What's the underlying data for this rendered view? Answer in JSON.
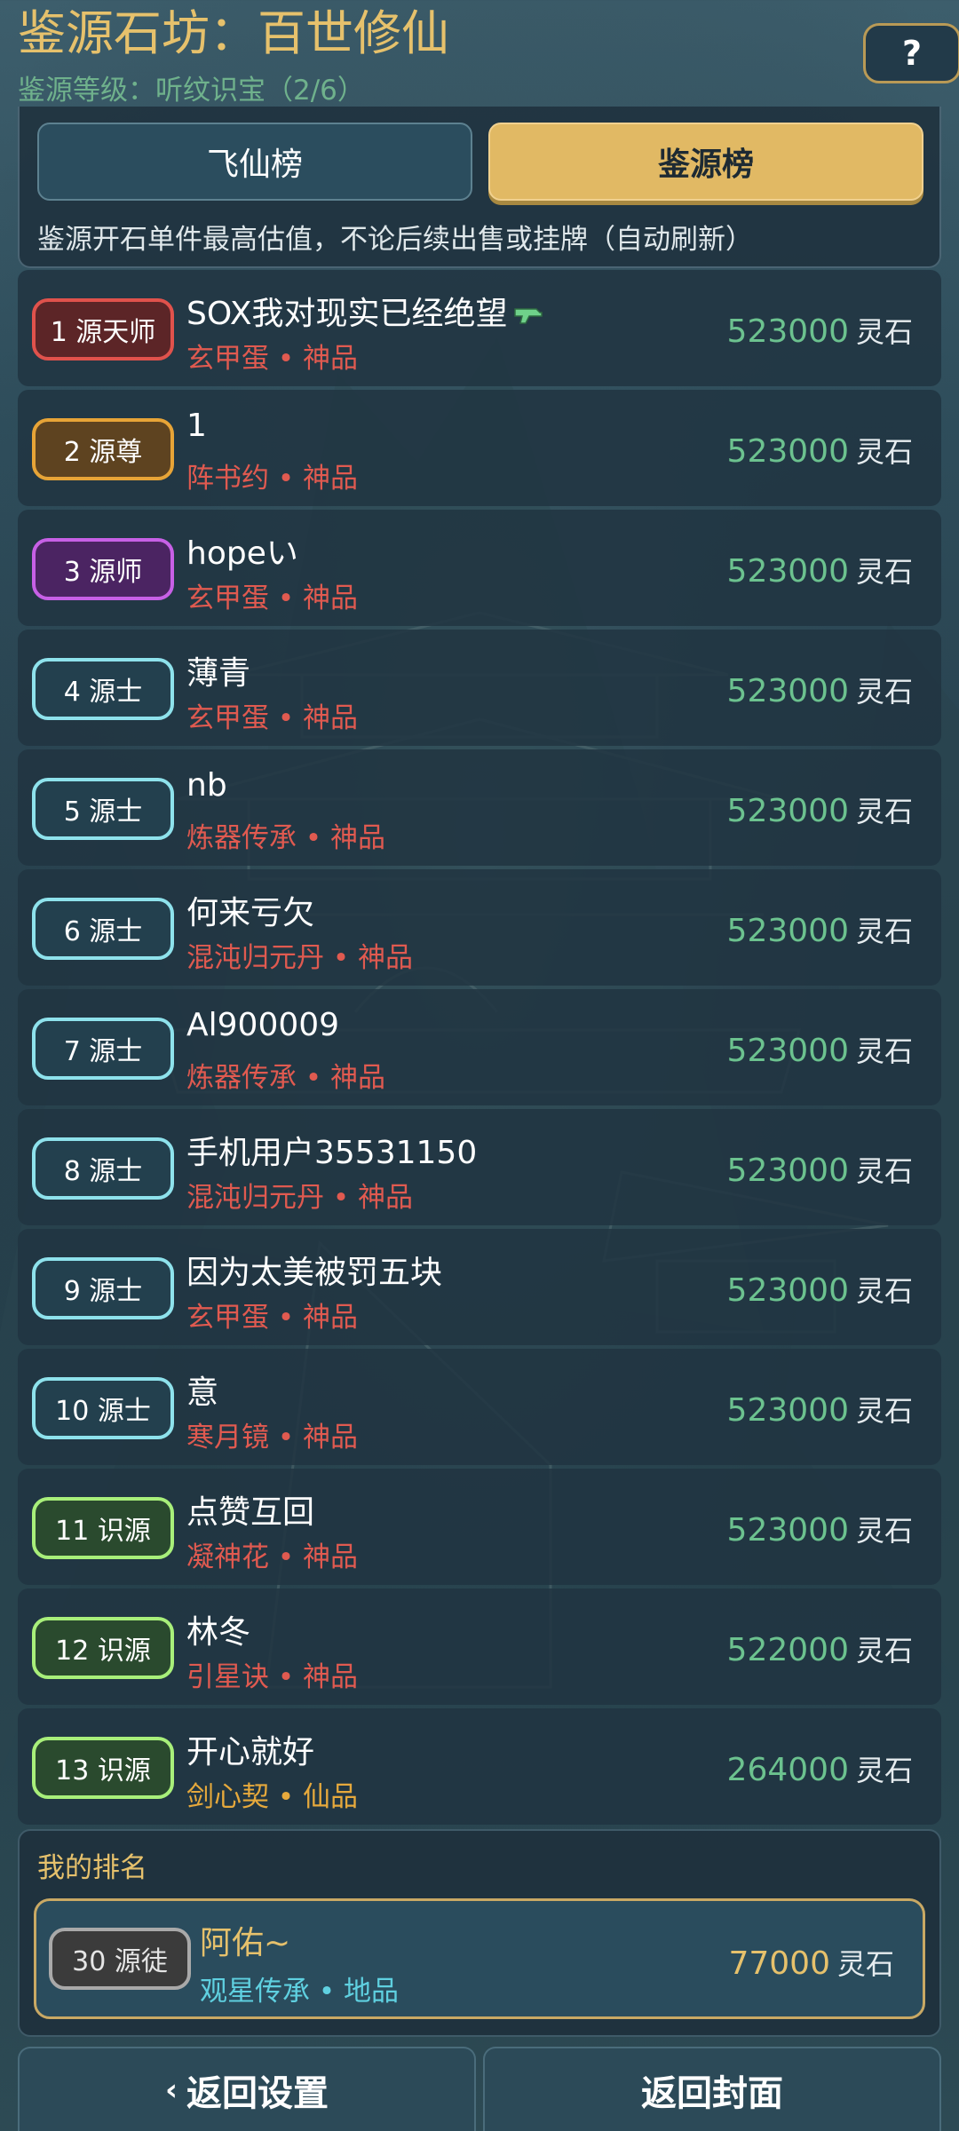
{
  "header": {
    "title": "鉴源石坊：百世修仙",
    "subtitle": "鉴源等级：听纹识宝（2/6）",
    "help_label": "?"
  },
  "tabs": [
    {
      "label": "飞仙榜",
      "active": false
    },
    {
      "label": "鉴源榜",
      "active": true
    }
  ],
  "description": "鉴源开石单件最高估值，不论后续出售或挂牌（自动刷新）",
  "unit": "灵石",
  "colors": {
    "tier_天师": {
      "border": "#e0524c",
      "bg": "#5c2527"
    },
    "tier_源尊": {
      "border": "#e7a437",
      "bg": "#5e4320"
    },
    "tier_源师": {
      "border": "#c760e6",
      "bg": "#4b2462"
    },
    "tier_源士": {
      "border": "#8ee2ec",
      "bg": "#23404e"
    },
    "tier_识源": {
      "border": "#a8ef7a",
      "bg": "#2a4a2e"
    },
    "grade_神品": "#e05a50",
    "grade_仙品": "#e6a93c",
    "value_green": "#6cc28f",
    "gold": "#e6c16c"
  },
  "rankings": [
    {
      "rank_label": "1 源天师",
      "tier": "天师",
      "name": "SOX我对现实已经绝望",
      "icon": "water-gun-icon",
      "item": "玄甲蛋 • 神品",
      "grade": "神品",
      "value": "523000"
    },
    {
      "rank_label": "2 源尊",
      "tier": "源尊",
      "name": "1",
      "item": "阵书约 • 神品",
      "grade": "神品",
      "value": "523000"
    },
    {
      "rank_label": "3 源师",
      "tier": "源师",
      "name": "hopeい",
      "item": "玄甲蛋 • 神品",
      "grade": "神品",
      "value": "523000"
    },
    {
      "rank_label": "4 源士",
      "tier": "源士",
      "name": "薄青",
      "item": "玄甲蛋 • 神品",
      "grade": "神品",
      "value": "523000"
    },
    {
      "rank_label": "5 源士",
      "tier": "源士",
      "name": "nb",
      "item": "炼器传承 • 神品",
      "grade": "神品",
      "value": "523000"
    },
    {
      "rank_label": "6 源士",
      "tier": "源士",
      "name": "何来亏欠",
      "item": "混沌归元丹 • 神品",
      "grade": "神品",
      "value": "523000"
    },
    {
      "rank_label": "7 源士",
      "tier": "源士",
      "name": " Al900009",
      "item": "炼器传承 • 神品",
      "grade": "神品",
      "value": "523000"
    },
    {
      "rank_label": "8 源士",
      "tier": "源士",
      "name": "手机用户35531150",
      "item": "混沌归元丹 • 神品",
      "grade": "神品",
      "value": "523000"
    },
    {
      "rank_label": "9 源士",
      "tier": "源士",
      "name": "因为太美被罚五块",
      "item": "玄甲蛋 • 神品",
      "grade": "神品",
      "value": "523000"
    },
    {
      "rank_label": "10 源士",
      "tier": "源士",
      "name": "意",
      "item": "寒月镜 • 神品",
      "grade": "神品",
      "value": "523000"
    },
    {
      "rank_label": "11 识源",
      "tier": "识源",
      "name": "点赞互回",
      "item": "凝神花 • 神品",
      "grade": "神品",
      "value": "523000"
    },
    {
      "rank_label": "12 识源",
      "tier": "识源",
      "name": "林冬",
      "item": "引星诀 • 神品",
      "grade": "神品",
      "value": "522000"
    },
    {
      "rank_label": "13 识源",
      "tier": "识源",
      "name": "开心就好",
      "item": "剑心契 • 仙品",
      "grade": "仙品",
      "value": "264000"
    }
  ],
  "my_rank": {
    "label": "我的排名",
    "rank_label": "30 源徒",
    "name": "阿佑~",
    "item": "观星传承 • 地品",
    "value": "77000"
  },
  "buttons": {
    "back_settings": "返回设置",
    "back_settings_icon": "chevron-left-icon",
    "back_cover": "返回封面"
  }
}
